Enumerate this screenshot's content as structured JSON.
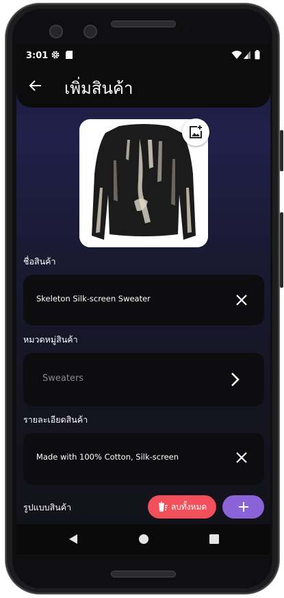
{
  "status_bar": {
    "time": "3:01",
    "icons_left": [
      "gear-icon",
      "sd-card-icon"
    ],
    "icons_right": [
      "wifi-icon",
      "signal-icon",
      "battery-icon"
    ]
  },
  "app_bar": {
    "back_icon": "arrow-left-icon",
    "title": "เพิ่มสินค้า"
  },
  "product_image": {
    "add_photo_icon": "add-photo-icon"
  },
  "form": {
    "name": {
      "label": "ชื่อสินค้า",
      "value": "Skeleton Silk-screen Sweater",
      "action_icon": "close-icon"
    },
    "category": {
      "label": "หมวดหมู่สินค้า",
      "placeholder": "Sweaters",
      "action_icon": "chevron-right-icon"
    },
    "description": {
      "label": "รายละเอียดสินค้า",
      "value": "Made with 100% Cotton, Silk-screen",
      "action_icon": "close-icon"
    },
    "variants": {
      "label": "รูปแบบสินค้า"
    }
  },
  "buttons": {
    "clear_all": "ลบทั้งหมด",
    "add": "+"
  },
  "colors": {
    "clear_button": "#f14f5a",
    "add_button": "#8a63d8",
    "field_bg": "#0d0d0f"
  },
  "nav_bar": {
    "icons": [
      "back-triangle-icon",
      "home-circle-icon",
      "recents-square-icon"
    ]
  }
}
